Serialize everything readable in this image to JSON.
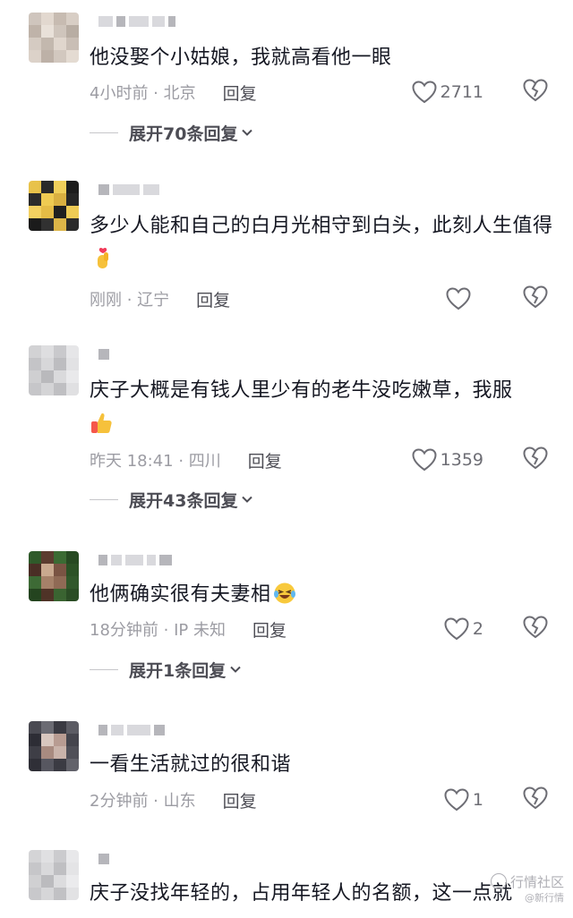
{
  "comments": [
    {
      "text": "他没娶个小姑娘，我就高看他一眼",
      "time_location": "4小时前 · 北京",
      "reply_label": "回复",
      "like_count": "2711",
      "expand_label": "展开70条回复",
      "avatar_colors": [
        "#cfc5bd",
        "#e2d8cf",
        "#c7bbb1",
        "#d8cec5",
        "#bfb3a9",
        "#e9e1d9",
        "#cfc5bc",
        "#b8ada3",
        "#d5cbc2",
        "#c3b8ae",
        "#e0d6cd",
        "#c9beb5",
        "#dcd2c9",
        "#bdb1a7",
        "#d2c8bf",
        "#e4dbd2"
      ]
    },
    {
      "text": "多少人能和自己的白月光相守到白头，此刻人生值得",
      "emoji": "finger-heart-emoji",
      "time_location": "刚刚 · 辽宁",
      "reply_label": "回复",
      "like_count": "",
      "avatar_colors": [
        "#e8c24a",
        "#2a2a2a",
        "#f0cf5a",
        "#1d1d1d",
        "#2b2b2b",
        "#efcb52",
        "#d9b041",
        "#262626",
        "#f2d061",
        "#e5bc46",
        "#202020",
        "#eecb55",
        "#1b1b1b",
        "#313131",
        "#dcb548",
        "#2a2a2a"
      ]
    },
    {
      "text": "庆子大概是有钱人里少有的老牛没吃嫩草，我服",
      "emoji": "thumbs-up-emoji",
      "time_location": "昨天 18:41 · 四川",
      "reply_label": "回复",
      "like_count": "1359",
      "expand_label": "展开43条回复",
      "avatar_colors": [
        "#d2d2d4",
        "#dedee0",
        "#c9c9cc",
        "#e6e6e8",
        "#c4c4c7",
        "#d7d7d9",
        "#bdbdc0",
        "#e2e2e4",
        "#cfcfd1",
        "#b9b9bc",
        "#dadadc",
        "#e9e9eb",
        "#c6c6c9",
        "#d4d4d6",
        "#bfbfc2",
        "#e0e0e2"
      ]
    },
    {
      "text": "他俩确实很有夫妻相",
      "emoji": "laughing-crying-emoji",
      "time_location": "18分钟前 · IP 未知",
      "reply_label": "回复",
      "like_count": "2",
      "expand_label": "展开1条回复",
      "avatar_colors": [
        "#2f5a2a",
        "#5b3c2f",
        "#3b6b33",
        "#274a22",
        "#4a2e25",
        "#c9a98f",
        "#7a5443",
        "#2c5226",
        "#3d6a35",
        "#a58169",
        "#8f6a55",
        "#31582b",
        "#24441f",
        "#4f3327",
        "#3a6431",
        "#2b4d25"
      ]
    },
    {
      "text": "一看生活就过的很和谐",
      "time_location": "2分钟前 · 山东",
      "reply_label": "回复",
      "like_count": "1",
      "avatar_colors": [
        "#4a4a52",
        "#6b6b73",
        "#3a3a42",
        "#5c5c64",
        "#2d2d35",
        "#d8c7bf",
        "#b89c92",
        "#45454d",
        "#3e3e46",
        "#a88b80",
        "#c9b3aa",
        "#505058",
        "#2f2f37",
        "#575760",
        "#3b3b43",
        "#62626a"
      ]
    },
    {
      "text": "庆子没找年轻的，占用年轻人的名额，这一点就",
      "avatar_colors": [
        "#d4d4d6",
        "#e0e0e2",
        "#cbcbce",
        "#e8e8ea",
        "#c6c6c9",
        "#d9d9db",
        "#bfbfc2",
        "#e4e4e6",
        "#d0d0d2",
        "#bbbbbe",
        "#dcdcde",
        "#ebebed",
        "#c8c8cb",
        "#d6d6d8",
        "#c1c1c4",
        "#e2e2e4"
      ]
    }
  ],
  "watermark": {
    "line1": "行情社区",
    "line2": "@新行情"
  },
  "colors": {
    "text": "#161823",
    "meta": "#9c9ca3",
    "reply": "#4d4d55",
    "icon": "#6d6d74"
  }
}
